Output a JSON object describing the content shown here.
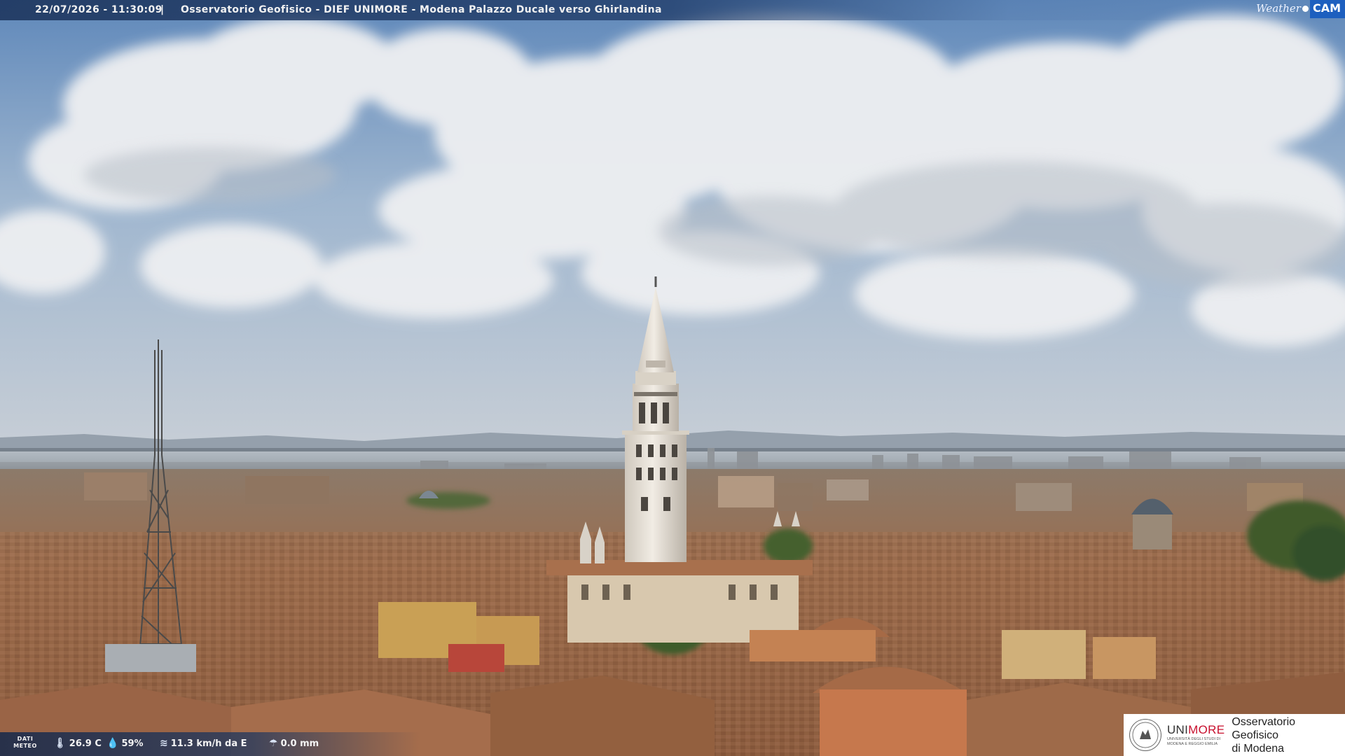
{
  "overlay": {
    "timestamp": "22/07/2026 - 11:30:09",
    "separator": "|",
    "title": "Osservatorio Geofisico - DIEF UNIMORE - Modena Palazzo Ducale verso Ghirlandina"
  },
  "brand_logo": {
    "weather": "Weather",
    "cam": "CAM"
  },
  "meteo": {
    "label_line1": "DATI",
    "label_line2": "METEO",
    "temperature": "26.9 C",
    "humidity": "59%",
    "wind": "11.3 km/h da E",
    "rain": "0.0 mm",
    "icons": {
      "temperature": "thermometer-icon",
      "humidity": "drop-icon",
      "wind": "wind-icon",
      "rain": "rain-gauge-icon"
    }
  },
  "institution_logo": {
    "unimore_a": "UNI",
    "unimore_b": "MORE",
    "unimore_sub1": "UNIVERSITÀ DEGLI STUDI DI",
    "unimore_sub2": "MODENA E REGGIO EMILIA",
    "observatory_line1": "Osservatorio Geofisico",
    "observatory_line2": "di Modena"
  },
  "colors": {
    "sky_top": "#6f96c4",
    "cloud": "#eef0f3",
    "roof": "#a2724f",
    "tower": "#e9e4dc",
    "unimore_red": "#c8102e",
    "cam_blue": "#1d5fbf"
  }
}
